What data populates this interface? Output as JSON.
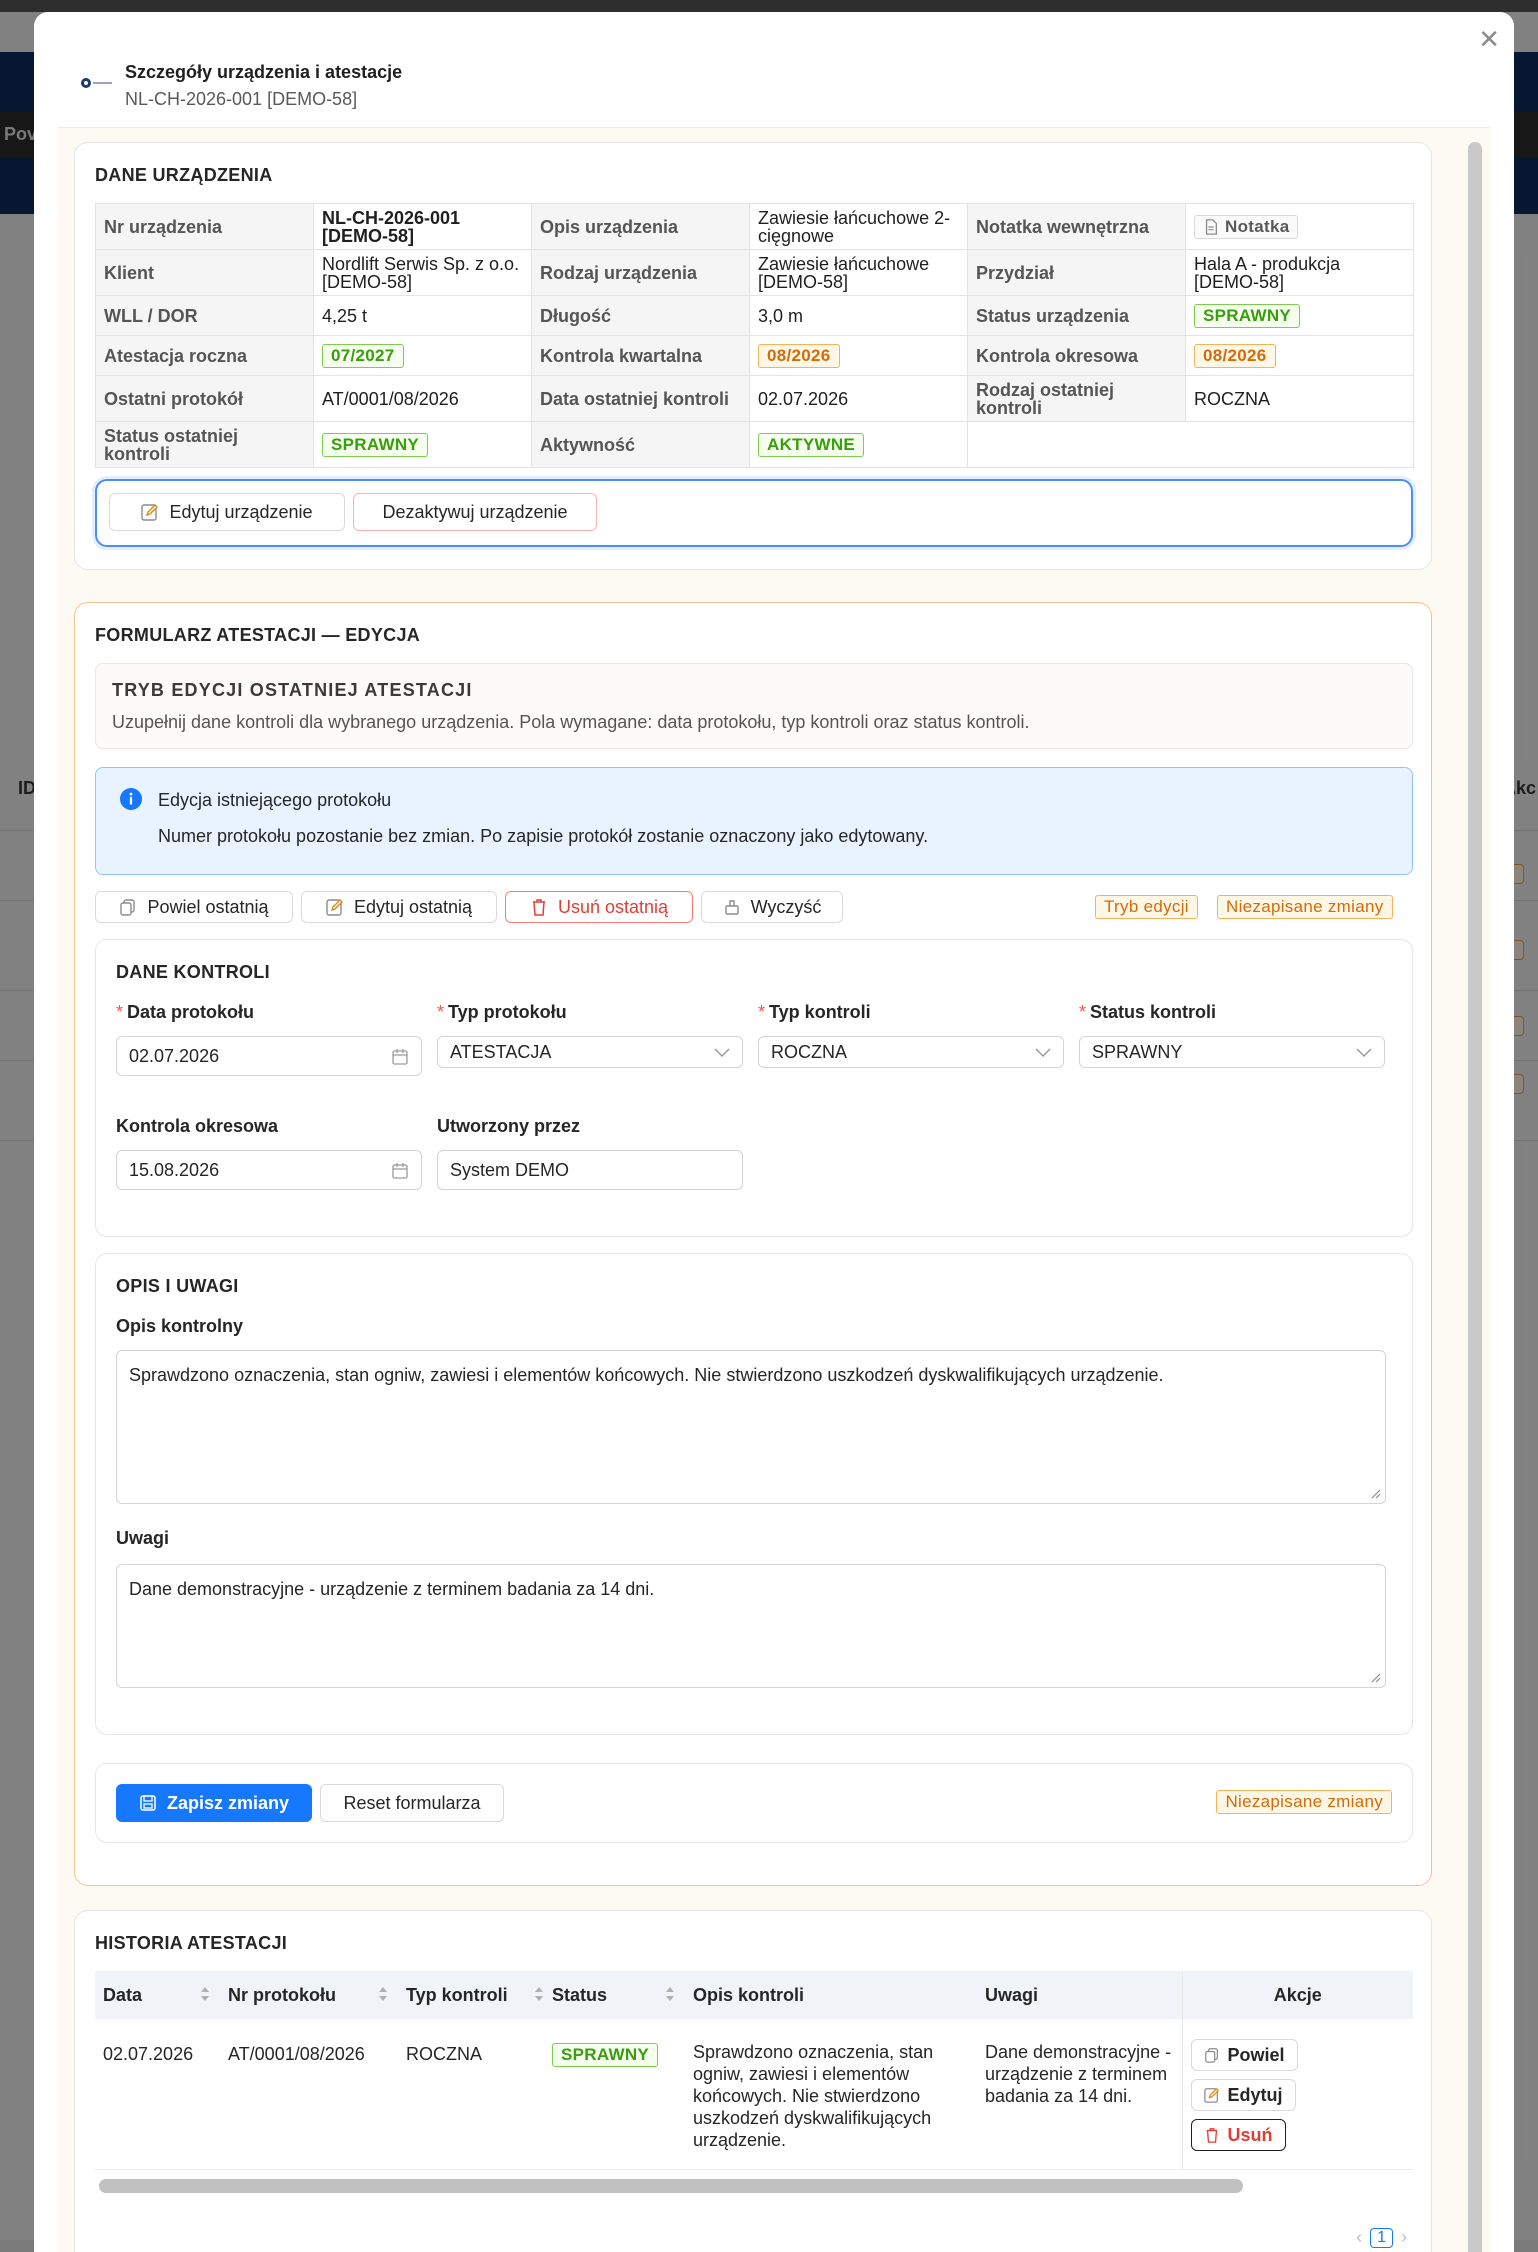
{
  "modal": {
    "title": "Szczegóły urządzenia i atestacje",
    "subtitle": "NL-CH-2026-001 [DEMO-58]",
    "close_icon": "close-icon"
  },
  "device": {
    "section_title": "DANE URZĄDZENIA",
    "rows": [
      {
        "l1": "Nr urządzenia",
        "v1": "NL-CH-2026-001 [DEMO-58]",
        "l2": "Opis urządzenia",
        "v2": "Zawiesie łańcuchowe 2-cięgnowe",
        "l3": "Notatka wewnętrzna",
        "v3": "Notatka"
      },
      {
        "l1": "Klient",
        "v1": "Nordlift Serwis Sp. z o.o. [DEMO-58]",
        "l2": "Rodzaj urządzenia",
        "v2": "Zawiesie łańcuchowe [DEMO-58]",
        "l3": "Przydział",
        "v3": "Hala A - produkcja [DEMO-58]"
      },
      {
        "l1": "WLL / DOR",
        "v1": "4,25 t",
        "l2": "Długość",
        "v2": "3,0 m",
        "l3": "Status urządzenia",
        "v3": "SPRAWNY"
      },
      {
        "l1": "Atestacja roczna",
        "v1": "07/2027",
        "l2": "Kontrola kwartalna",
        "v2": "08/2026",
        "l3": "Kontrola okresowa",
        "v3": "08/2026"
      },
      {
        "l1": "Ostatni protokół",
        "v1": "AT/0001/08/2026",
        "l2": "Data ostatniej kontroli",
        "v2": "02.07.2026",
        "l3": "Rodzaj ostatniej kontroli",
        "v3": "ROCZNA"
      },
      {
        "l1": "Status ostatniej kontroli",
        "v1": "SPRAWNY",
        "l2": "Aktywność",
        "v2": "AKTYWNE"
      }
    ],
    "edit_button": "Edytuj urządzenie",
    "deactivate_button": "Dezaktywuj urządzenie"
  },
  "form": {
    "section_title": "FORMULARZ ATESTACJI — EDYCJA",
    "mode_title": "TRYB EDYCJI OSTATNIEJ ATESTACJI",
    "mode_desc": "Uzupełnij dane kontroli dla wybranego urządzenia. Pola wymagane: data protokołu, typ kontroli oraz status kontroli.",
    "info_title": "Edycja istniejącego protokołu",
    "info_desc": "Numer protokołu pozostanie bez zmian. Po zapisie protokół zostanie oznaczony jako edytowany.",
    "btn_copy_last": "Powiel ostatnią",
    "btn_edit_last": "Edytuj ostatnią",
    "btn_delete_last": "Usuń ostatnią",
    "btn_clear": "Wyczyść",
    "tag_edit_mode": "Tryb edycji",
    "tag_unsaved": "Niezapisane zmiany",
    "control": {
      "title": "DANE KONTROLI",
      "date_label": "Data protokołu",
      "date_value": "02.07.2026",
      "protocol_type_label": "Typ protokołu",
      "protocol_type_value": "ATESTACJA",
      "control_type_label": "Typ kontroli",
      "control_type_value": "ROCZNA",
      "status_label": "Status kontroli",
      "status_value": "SPRAWNY",
      "periodic_label": "Kontrola okresowa",
      "periodic_value": "15.08.2026",
      "created_by_label": "Utworzony przez",
      "created_by_value": "System DEMO"
    },
    "notes": {
      "title": "OPIS I UWAGI",
      "desc_label": "Opis kontrolny",
      "desc_value": "Sprawdzono oznaczenia, stan ogniw, zawiesi i elementów końcowych. Nie stwierdzono uszkodzeń dyskwalifikujących urządzenie.",
      "remarks_label": "Uwagi",
      "remarks_value": "Dane demonstracyjne - urządzenie z terminem badania za 14 dni."
    },
    "save_button": "Zapisz zmiany",
    "reset_button": "Reset formularza",
    "unsaved_tag": "Niezapisane zmiany"
  },
  "history": {
    "section_title": "HISTORIA ATESTACJI",
    "columns": [
      "Data",
      "Nr protokołu",
      "Typ kontroli",
      "Status",
      "Opis kontroli",
      "Uwagi",
      "Akcje"
    ],
    "rows": [
      {
        "date": "02.07.2026",
        "protocol": "AT/0001/08/2026",
        "type": "ROCZNA",
        "status": "SPRAWNY",
        "desc": "Sprawdzono oznaczenia, stan ogniw, zawiesi i elementów końcowych. Nie stwierdzono uszkodzeń dyskwalifikujących urządzenie.",
        "remarks": "Dane demonstracyjne - urządzenie z terminem badania za 14 dni.",
        "actions": {
          "copy": "Powiel",
          "edit": "Edytuj",
          "delete": "Usuń"
        }
      }
    ],
    "pagination_current": "1"
  },
  "background": {
    "menu_partial": "Pov",
    "col_id": "ID",
    "col_actions": "Akc"
  },
  "colors": {
    "primary": "#1677ff",
    "success": "#389e0d",
    "warning": "#d46b08",
    "danger": "#e23d35"
  }
}
